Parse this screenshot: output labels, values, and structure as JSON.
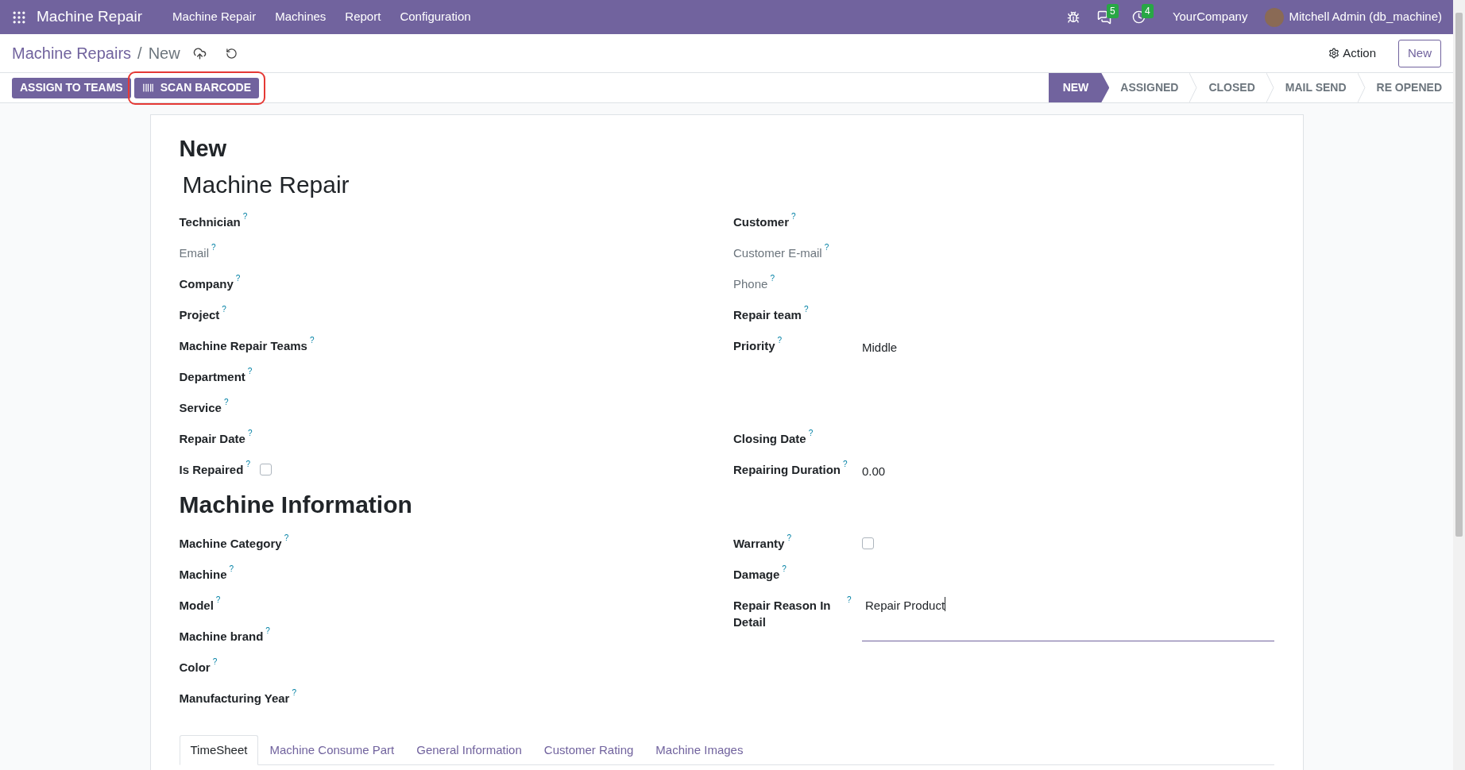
{
  "navbar": {
    "app_name": "Machine Repair",
    "menu": [
      "Machine Repair",
      "Machines",
      "Report",
      "Configuration"
    ],
    "messages_count": "5",
    "activities_count": "4",
    "company": "YourCompany",
    "user": "Mitchell Admin (db_machine)"
  },
  "breadcrumb": {
    "parent": "Machine Repairs",
    "separator": "/",
    "current": "New"
  },
  "control_panel": {
    "action": "Action",
    "new_button": "New"
  },
  "header_buttons": [
    {
      "label": "ASSIGN TO TEAMS",
      "kind": "plain",
      "highlighted": false
    },
    {
      "label": "SCAN BARCODE",
      "kind": "barcode",
      "highlighted": true
    }
  ],
  "stages": [
    {
      "label": "NEW",
      "selected": true
    },
    {
      "label": "ASSIGNED",
      "selected": false
    },
    {
      "label": "CLOSED",
      "selected": false
    },
    {
      "label": "MAIL SEND",
      "selected": false
    },
    {
      "label": "RE OPENED",
      "selected": false
    }
  ],
  "sheet": {
    "title": "New",
    "name": "Machine Repair",
    "main_rows": [
      {
        "left": {
          "label": "Technician",
          "help": "?",
          "kind": "plain",
          "readonly": false
        },
        "right": {
          "label": "Customer",
          "help": "?",
          "kind": "plain",
          "readonly": false
        }
      },
      {
        "left": {
          "label": "Email",
          "help": "?",
          "kind": "plain",
          "readonly": true
        },
        "right": {
          "label": "Customer E-mail",
          "help": "?",
          "kind": "plain",
          "readonly": true
        }
      },
      {
        "left": {
          "label": "Company",
          "help": "?",
          "kind": "plain",
          "readonly": false
        },
        "right": {
          "label": "Phone",
          "help": "?",
          "kind": "plain",
          "readonly": true
        }
      },
      {
        "left": {
          "label": "Project",
          "help": "?",
          "kind": "plain",
          "readonly": false
        },
        "right": {
          "label": "Repair team",
          "help": "?",
          "kind": "plain",
          "readonly": false
        }
      },
      {
        "left": {
          "label": "Machine Repair Teams",
          "help": "?",
          "kind": "plain",
          "readonly": false
        },
        "right": {
          "label": "Priority",
          "help": "?",
          "kind": "value",
          "readonly": false,
          "value": "Middle"
        }
      },
      {
        "left": {
          "label": "Department",
          "help": "?",
          "kind": "plain",
          "readonly": false
        }
      },
      {
        "left": {
          "label": "Service",
          "help": "?",
          "kind": "plain",
          "readonly": false
        }
      },
      {
        "left": {
          "label": "Repair Date",
          "help": "?",
          "kind": "plain",
          "readonly": false
        },
        "right": {
          "label": "Closing Date",
          "help": "?",
          "kind": "plain",
          "readonly": false
        }
      },
      {
        "left": {
          "label": "Is Repaired",
          "help": "?",
          "kind": "checkbox",
          "readonly": false,
          "checked": false
        },
        "right": {
          "label": "Repairing Duration",
          "help": "?",
          "kind": "value",
          "readonly": false,
          "value": "0.00"
        }
      }
    ],
    "section_heading": "Machine Information",
    "section_rows": [
      {
        "left": {
          "label": "Machine Category",
          "help": "?",
          "kind": "plain",
          "readonly": false
        },
        "right": {
          "label": "Warranty",
          "help": "?",
          "kind": "checkbox",
          "readonly": false,
          "checked": false
        }
      },
      {
        "left": {
          "label": "Machine",
          "help": "?",
          "kind": "plain",
          "readonly": false
        },
        "right": {
          "label": "Damage",
          "help": "?",
          "kind": "plain",
          "readonly": false
        }
      },
      {
        "left": {
          "label": "Model",
          "help": "?",
          "kind": "plain",
          "readonly": false
        },
        "right": {
          "label": "Repair Reason In Detail",
          "help": "?",
          "kind": "textarea",
          "readonly": false,
          "value": "Repair Product"
        }
      },
      {
        "left": {
          "label": "Machine brand",
          "help": "?",
          "kind": "plain",
          "readonly": false
        }
      },
      {
        "left": {
          "label": "Color",
          "help": "?",
          "kind": "plain",
          "readonly": false
        }
      },
      {
        "left": {
          "label": "Manufacturing Year",
          "help": "?",
          "kind": "plain",
          "readonly": false
        }
      }
    ],
    "tabs": [
      {
        "label": "TimeSheet",
        "selected": true
      },
      {
        "label": "Machine Consume Part",
        "selected": false
      },
      {
        "label": "General Information",
        "selected": false
      },
      {
        "label": "Customer Rating",
        "selected": false
      },
      {
        "label": "Machine Images",
        "selected": false
      }
    ]
  }
}
